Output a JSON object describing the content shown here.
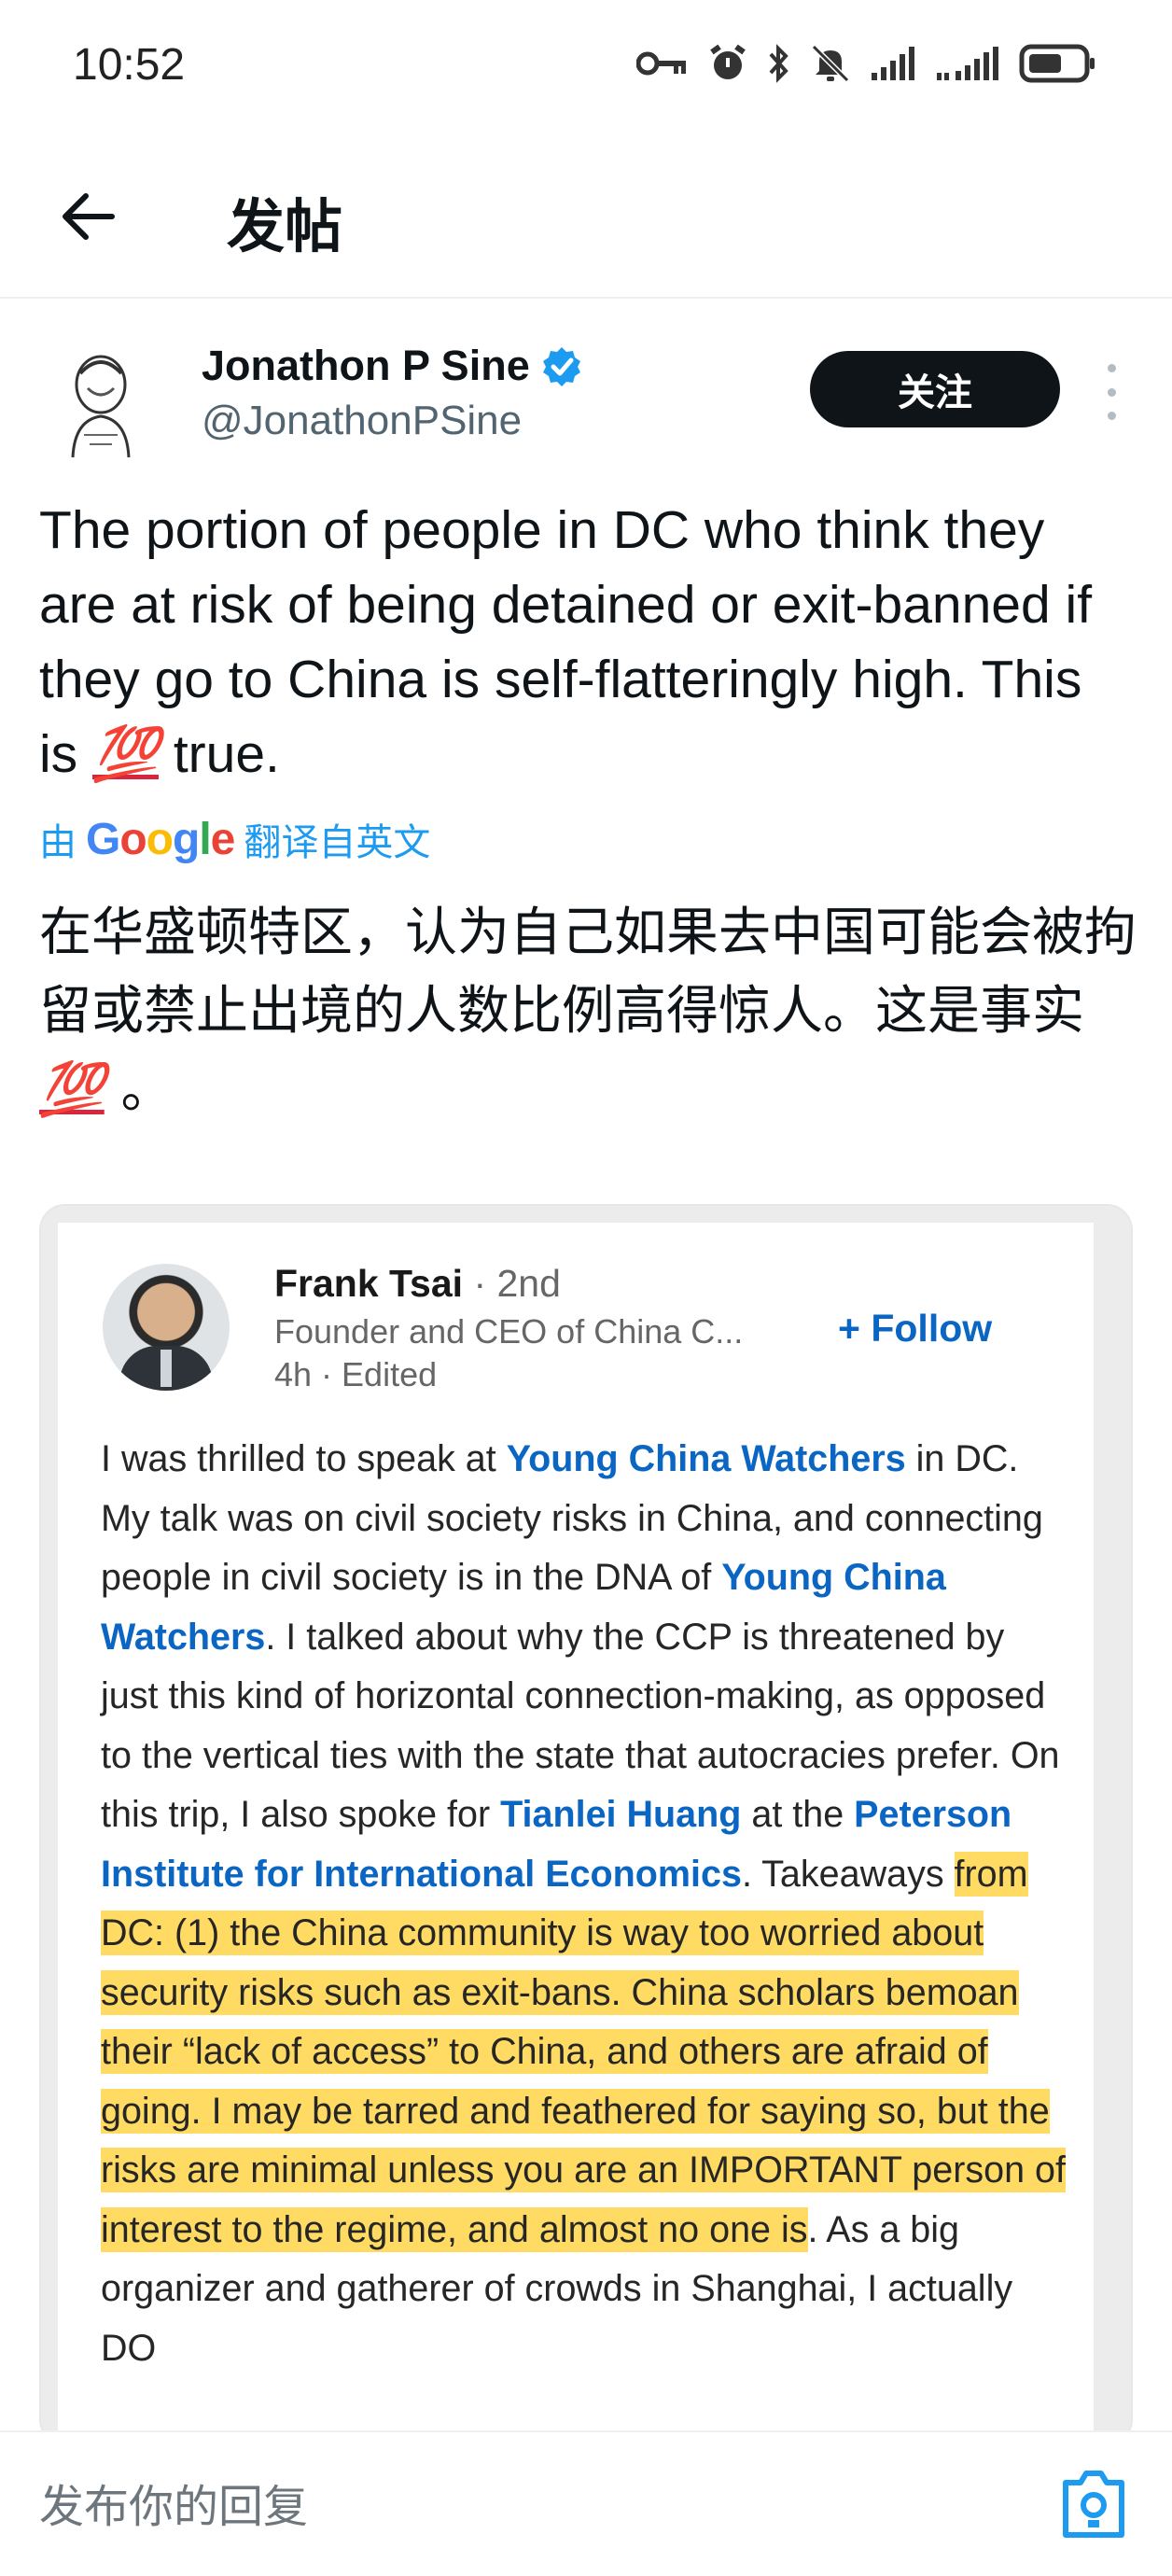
{
  "status_bar": {
    "time": "10:52",
    "icons": [
      "key-icon",
      "alarm-icon",
      "bluetooth-icon",
      "mute-icon",
      "signal-icon",
      "signal-icon-2",
      "battery-icon"
    ]
  },
  "header": {
    "title": "发帖",
    "back_icon": "arrow-left-icon"
  },
  "post": {
    "author_name": "Jonathon P Sine",
    "author_handle": "@JonathonPSine",
    "verified": true,
    "follow_label": "关注",
    "text_before_emoji": "The portion of people in DC who think they are at risk of being detained or exit-banned if they go to China is self-flatteringly high. This is ",
    "emoji": "💯",
    "text_after_emoji": " true.",
    "translate": {
      "prefix": "由",
      "provider": "Google",
      "suffix": "翻译自英文"
    },
    "translated_text_before_emoji": "在华盛顿特区，认为自己如果去中国可能会被拘留或禁止出境的人数比例高得惊人。这是事实",
    "translated_emoji": "💯",
    "translated_text_after_emoji": " 。"
  },
  "embed": {
    "name": "Frank Tsai",
    "degree": " · 2nd",
    "headline": "Founder and CEO of China C...",
    "meta": "4h · Edited",
    "follow_label": "+ Follow",
    "body": {
      "t1": "I was thrilled to speak at ",
      "l1": "Young China Watchers",
      "t2": " in DC. My talk was on civil society risks in China, and connecting people in civil society is in the DNA of ",
      "l2": "Young China Watchers",
      "t3": ". I talked about why the CCP is threatened by just this kind of horizontal connection-making, as opposed to the vertical ties with the state that autocracies prefer. On this trip, I also spoke for ",
      "l3": "Tianlei Huang",
      "t4": " at the ",
      "l4": "Peterson Institute for International Economics",
      "t5": ". Takeaways ",
      "highlight": "from DC: (1) the China community is way too worried about security risks such as exit-bans. China scholars bemoan their “lack of access” to China, and others are afraid of going. I may be tarred and feathered for saying so, but the risks are minimal unless you are an IMPORTANT person of interest to the regime, and almost no one is",
      "t6": ". As a big organizer and gatherer of crowds in Shanghai, I actually DO"
    }
  },
  "reply_bar": {
    "placeholder": "发布你的回复"
  },
  "colors": {
    "accent": "#1d9bf0",
    "linkedin_blue": "#0a66c2",
    "highlight": "#ffcd28"
  }
}
